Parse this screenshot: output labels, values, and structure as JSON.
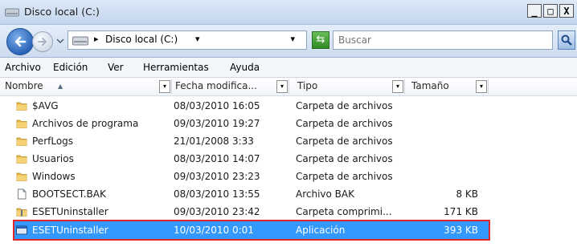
{
  "window": {
    "title": "Disco local (C:)",
    "controls": {
      "minimize": "_",
      "maximize": "□",
      "close": "X"
    }
  },
  "address": {
    "path_label": "Disco local (C:)",
    "path_sep": "▸",
    "path_drop": "▾",
    "search_placeholder": "Buscar"
  },
  "menu": {
    "items": [
      {
        "label": "Archivo"
      },
      {
        "label": "Edición"
      },
      {
        "label": "Ver"
      },
      {
        "label": "Herramientas"
      },
      {
        "label": "Ayuda"
      }
    ]
  },
  "columns": {
    "name": "Nombre",
    "date": "Fecha modifica...",
    "type": "Tipo",
    "size": "Tamaño",
    "drop": "▾"
  },
  "files": [
    {
      "name": "$AVG",
      "date": "08/03/2010 16:05",
      "type": "Carpeta de archivos",
      "size": "",
      "icon": "folder-icon"
    },
    {
      "name": "Archivos de programa",
      "date": "09/03/2010 19:27",
      "type": "Carpeta de archivos",
      "size": "",
      "icon": "folder-icon"
    },
    {
      "name": "PerfLogs",
      "date": "21/01/2008 3:33",
      "type": "Carpeta de archivos",
      "size": "",
      "icon": "folder-icon"
    },
    {
      "name": "Usuarios",
      "date": "08/03/2010 14:07",
      "type": "Carpeta de archivos",
      "size": "",
      "icon": "folder-icon"
    },
    {
      "name": "Windows",
      "date": "09/03/2010 23:23",
      "type": "Carpeta de archivos",
      "size": "",
      "icon": "folder-icon"
    },
    {
      "name": "BOOTSECT.BAK",
      "date": "08/03/2010 13:55",
      "type": "Archivo BAK",
      "size": "8 KB",
      "icon": "file-icon"
    },
    {
      "name": "ESETUninstaller",
      "date": "09/03/2010 23:42",
      "type": "Carpeta comprimi...",
      "size": "171 KB",
      "icon": "zip-folder-icon"
    },
    {
      "name": "ESETUninstaller",
      "date": "10/03/2010 0:01",
      "type": "Aplicación",
      "size": "393 KB",
      "icon": "application-icon",
      "selected": true
    }
  ]
}
